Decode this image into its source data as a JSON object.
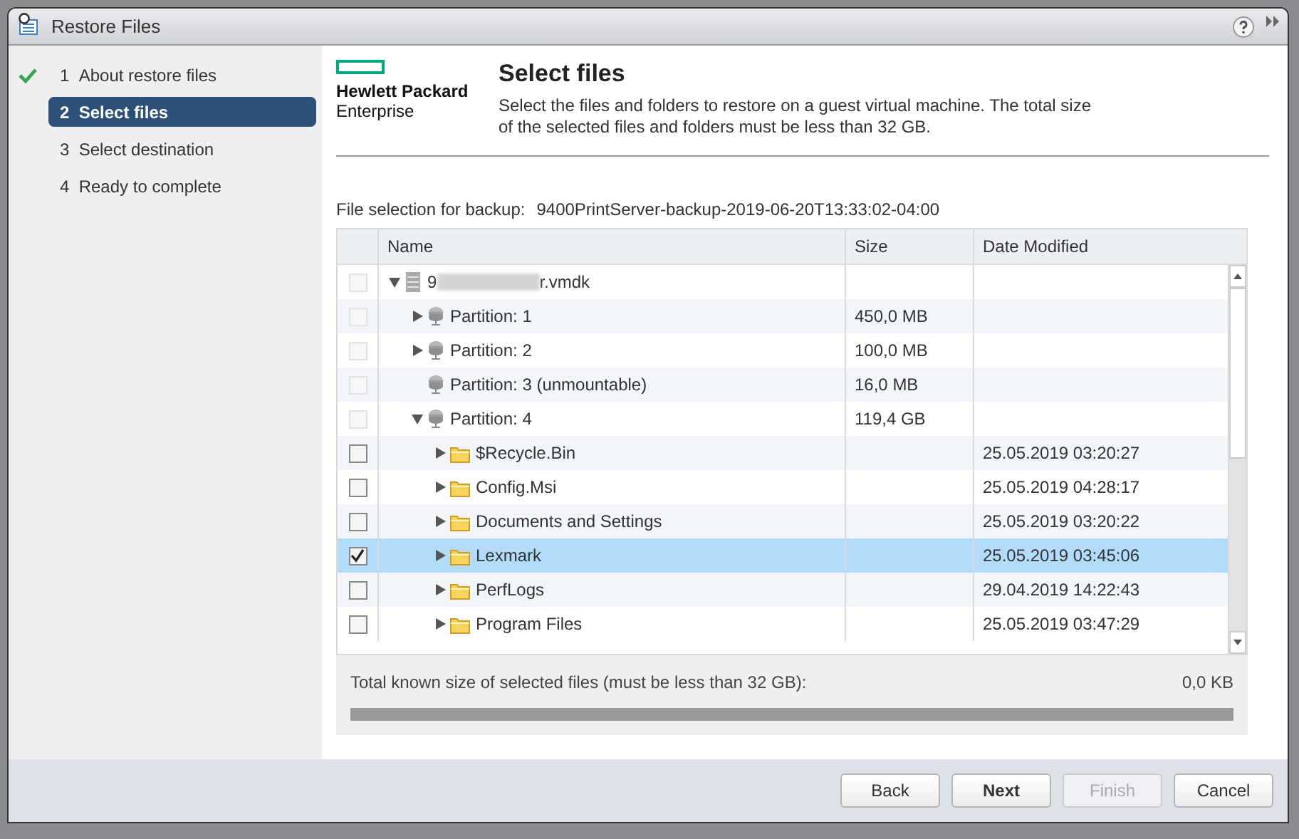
{
  "window": {
    "title": "Restore Files"
  },
  "steps": [
    {
      "number": "1",
      "label": "About restore files",
      "completed": true,
      "selected": false
    },
    {
      "number": "2",
      "label": "Select files",
      "completed": false,
      "selected": true
    },
    {
      "number": "3",
      "label": "Select destination",
      "completed": false,
      "selected": false
    },
    {
      "number": "4",
      "label": "Ready to complete",
      "completed": false,
      "selected": false
    }
  ],
  "logo": {
    "line_1": "Hewlett Packard",
    "line_2": "Enterprise"
  },
  "page": {
    "title": "Select files",
    "description": "Select the files and folders to restore on a guest virtual machine. The total size of the selected files and folders must be less than 32 GB."
  },
  "backup": {
    "label": "File selection for backup:",
    "value": "9400PrintServer-backup-2019-06-20T13:33:02-04:00"
  },
  "table": {
    "columns": [
      "Name",
      "Size",
      "Date Modified"
    ],
    "rows": [
      {
        "kind": "disk",
        "name_prefix": "9",
        "name": "r.vmdk",
        "checked": false,
        "disabled": true,
        "selected": false,
        "expanded": true,
        "children": [
          {
            "kind": "partition",
            "name": "Partition: 1",
            "size": "450,0 MB",
            "checked": false,
            "disabled": true,
            "selected": false,
            "expanded": false
          },
          {
            "kind": "partition",
            "name": "Partition: 2",
            "size": "100,0 MB",
            "checked": false,
            "disabled": true,
            "selected": false,
            "expanded": false
          },
          {
            "kind": "partition",
            "name": "Partition: 3 (unmountable)",
            "size": "16,0 MB",
            "checked": false,
            "disabled": true,
            "selected": false
          },
          {
            "kind": "partition",
            "name": "Partition: 4",
            "size": "119,4 GB",
            "checked": false,
            "disabled": true,
            "selected": false,
            "expanded": true,
            "children": [
              {
                "kind": "folder",
                "name": "$Recycle.Bin",
                "date": "25.05.2019 03:20:27",
                "checked": false,
                "disabled": false,
                "selected": false,
                "expanded": false
              },
              {
                "kind": "folder",
                "name": "Config.Msi",
                "date": "25.05.2019 04:28:17",
                "checked": false,
                "disabled": false,
                "selected": false,
                "expanded": false
              },
              {
                "kind": "folder",
                "name": "Documents and Settings",
                "date": "25.05.2019 03:20:22",
                "checked": false,
                "disabled": false,
                "selected": false,
                "expanded": false
              },
              {
                "kind": "folder",
                "name": "Lexmark",
                "date": "25.05.2019 03:45:06",
                "checked": true,
                "disabled": false,
                "selected": true,
                "expanded": false
              },
              {
                "kind": "folder",
                "name": "PerfLogs",
                "date": "29.04.2019 14:22:43",
                "checked": false,
                "disabled": false,
                "selected": false,
                "expanded": false
              },
              {
                "kind": "folder",
                "name": "Program Files",
                "date": "25.05.2019 03:47:29",
                "checked": false,
                "disabled": false,
                "selected": false,
                "expanded": false
              }
            ]
          }
        ]
      }
    ]
  },
  "summary": {
    "label": "Total known size of selected files (must be less than 32 GB):",
    "value": "0,0 KB",
    "level": 0
  },
  "buttons": [
    {
      "label": "Back",
      "kind": "default",
      "disabled": false
    },
    {
      "label": "Next",
      "kind": "primary",
      "disabled": false
    },
    {
      "label": "Finish",
      "kind": "default",
      "disabled": true
    },
    {
      "label": "Cancel",
      "kind": "default",
      "disabled": false
    }
  ]
}
